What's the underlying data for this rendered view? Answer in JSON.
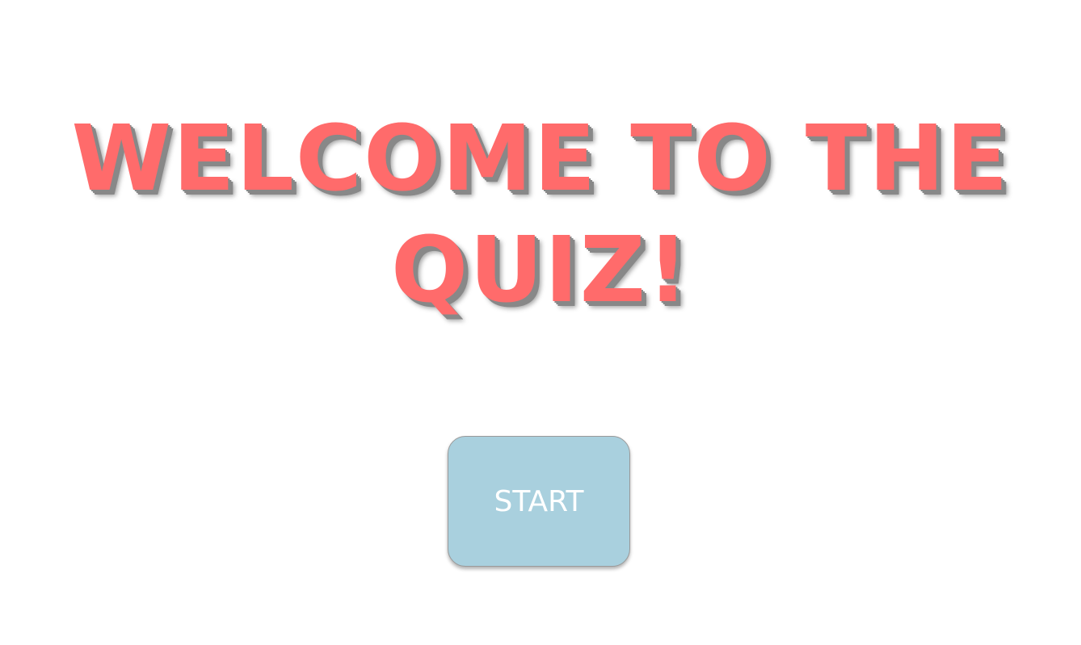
{
  "welcome": {
    "title": "WELCOME TO THE QUIZ!"
  },
  "start": {
    "label": "START"
  },
  "colors": {
    "title": "#ff6b6b",
    "title_shadow": "#888888",
    "button_background": "#a9d0de",
    "button_text": "#ffffff",
    "page_background": "#ffffff"
  }
}
